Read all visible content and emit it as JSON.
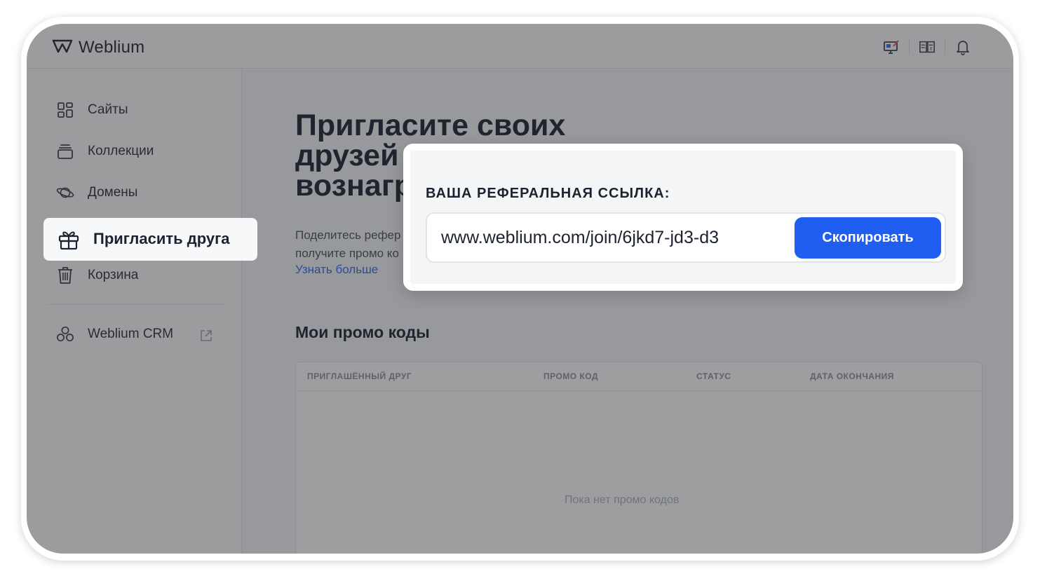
{
  "app": {
    "name": "Weblium"
  },
  "sidebar": {
    "items": [
      {
        "label": "Сайты",
        "icon": "grid-icon"
      },
      {
        "label": "Коллекции",
        "icon": "layers-icon"
      },
      {
        "label": "Домены",
        "icon": "planet-icon"
      },
      {
        "label": "Пригласить друга",
        "icon": "gift-icon",
        "active": true
      },
      {
        "label": "Корзина",
        "icon": "trash-icon"
      },
      {
        "label": "Weblium CRM",
        "icon": "crm-icon",
        "external": true
      }
    ]
  },
  "main": {
    "headline": [
      "Пригласите своих",
      "друзей",
      "вознагр"
    ],
    "description": [
      "Поделитесь рефер",
      "получите промо ко"
    ],
    "learn_more": "Узнать больше",
    "promo_title": "Мои промо коды",
    "table": {
      "columns": [
        "ПРИГЛАШЁННЫЙ ДРУГ",
        "ПРОМО КОД",
        "СТАТУС",
        "ДАТА ОКОНЧАНИЯ"
      ],
      "empty_text": "Пока нет промо кодов"
    }
  },
  "modal": {
    "label": "ВАША РЕФЕРАЛЬНАЯ ССЫЛКА:",
    "link": "www.weblium.com/join/6jkd7-jd3-d3",
    "copy_button": "Скопировать"
  },
  "colors": {
    "accent": "#1f5ef0",
    "link": "#2f6bf5",
    "overlay": "#28282c"
  }
}
